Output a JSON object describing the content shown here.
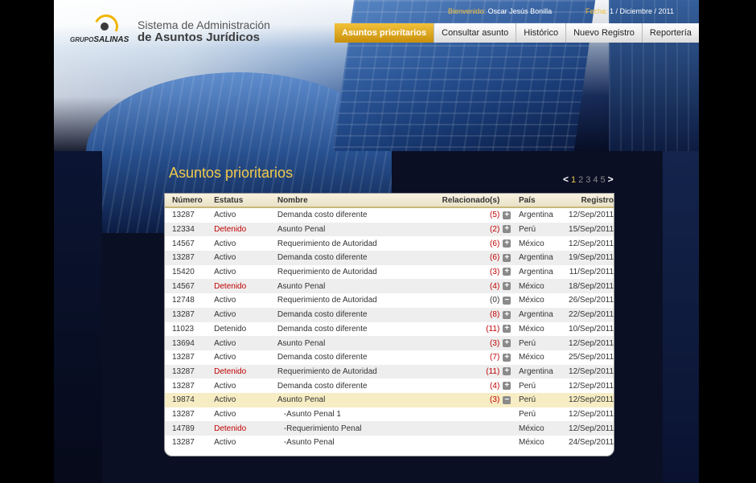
{
  "header": {
    "brand_small": "GRUPO",
    "brand_big": "SALINAS",
    "title_line1": "Sistema de Administración",
    "title_line2": "de Asuntos Jurídicos",
    "welcome_label": "Bienvenido:",
    "welcome_user": "Oscar Jesús Bonilla",
    "date_label": "Fecha:",
    "date_value": "1 / Diciembre / 2011"
  },
  "nav": [
    {
      "label": "Asuntos prioritarios",
      "active": true
    },
    {
      "label": "Consultar asunto",
      "active": false
    },
    {
      "label": "Histórico",
      "active": false
    },
    {
      "label": "Nuevo Registro",
      "active": false
    },
    {
      "label": "Reportería",
      "active": false
    }
  ],
  "section": {
    "title": "Asuntos prioritarios",
    "pager": {
      "prev": "<",
      "next": ">",
      "pages": [
        "1",
        "2",
        "3",
        "4",
        "5"
      ],
      "current": "1"
    }
  },
  "table": {
    "headers": {
      "numero": "Número",
      "estatus": "Estatus",
      "nombre": "Nombre",
      "relacionados": "Relacionado(s)",
      "pais": "País",
      "registro": "Registro"
    },
    "rows": [
      {
        "numero": "13287",
        "estatus": "Activo",
        "nombre": "Demanda costo diferente",
        "rel": "(5)",
        "rel_red": true,
        "toggle": "+",
        "pais": "Argentina",
        "registro": "12/Sep/2011"
      },
      {
        "numero": "12334",
        "estatus": "Detenido",
        "estatus_red": true,
        "nombre": "Asunto Penal",
        "rel": "(2)",
        "rel_red": true,
        "toggle": "+",
        "pais": "Perú",
        "registro": "15/Sep/2011"
      },
      {
        "numero": "14567",
        "estatus": "Activo",
        "nombre": "Requerimiento de Autoridad",
        "rel": "(6)",
        "rel_red": true,
        "toggle": "+",
        "pais": "México",
        "registro": "12/Sep/2011"
      },
      {
        "numero": "13287",
        "estatus": "Activo",
        "nombre": "Demanda costo diferente",
        "rel": "(6)",
        "rel_red": true,
        "toggle": "+",
        "pais": "Argentina",
        "registro": "19/Sep/2011"
      },
      {
        "numero": "15420",
        "estatus": "Activo",
        "nombre": "Requerimiento de Autoridad",
        "rel": "(3)",
        "rel_red": true,
        "toggle": "+",
        "pais": "Argentina",
        "registro": "11/Sep/2011"
      },
      {
        "numero": "14567",
        "estatus": "Detenido",
        "estatus_red": true,
        "nombre": "Asunto Penal",
        "rel": "(4)",
        "rel_red": true,
        "toggle": "+",
        "pais": "México",
        "registro": "18/Sep/2011"
      },
      {
        "numero": "12748",
        "estatus": "Activo",
        "nombre": "Requerimiento de Autoridad",
        "rel": "(0)",
        "rel_red": false,
        "toggle": "−",
        "pais": "México",
        "registro": "26/Sep/2011"
      },
      {
        "numero": "13287",
        "estatus": "Activo",
        "nombre": "Demanda costo diferente",
        "rel": "(8)",
        "rel_red": true,
        "toggle": "+",
        "pais": "Argentina",
        "registro": "22/Sep/2011"
      },
      {
        "numero": "11023",
        "estatus": "Detenido",
        "nombre": "Demanda costo diferente",
        "rel": "(11)",
        "rel_red": true,
        "toggle": "+",
        "pais": "México",
        "registro": "10/Sep/2011"
      },
      {
        "numero": "13694",
        "estatus": "Activo",
        "nombre": "Asunto Penal",
        "rel": "(3)",
        "rel_red": true,
        "toggle": "+",
        "pais": "Perú",
        "registro": "12/Sep/2011"
      },
      {
        "numero": "13287",
        "estatus": "Activo",
        "nombre": "Demanda costo diferente",
        "rel": "(7)",
        "rel_red": true,
        "toggle": "+",
        "pais": "México",
        "registro": "25/Sep/2011"
      },
      {
        "numero": "13287",
        "estatus": "Detenido",
        "estatus_red": true,
        "nombre": "Requerimiento de Autoridad",
        "rel": "(11)",
        "rel_red": true,
        "toggle": "+",
        "pais": "Argentina",
        "registro": "12/Sep/2011"
      },
      {
        "numero": "13287",
        "estatus": "Activo",
        "nombre": "Demanda costo diferente",
        "rel": "(4)",
        "rel_red": true,
        "toggle": "+",
        "pais": "Perú",
        "registro": "12/Sep/2011"
      },
      {
        "numero": "19874",
        "estatus": "Activo",
        "nombre": "Asunto Penal",
        "rel": "(3)",
        "rel_red": true,
        "toggle": "−",
        "pais": "Perú",
        "registro": "12/Sep/2011",
        "highlight": true
      },
      {
        "numero": "13287",
        "estatus": "Activo",
        "nombre": "-Asunto Penal 1",
        "rel": "",
        "toggle": "",
        "pais": "Perú",
        "registro": "12/Sep/2011",
        "child": true
      },
      {
        "numero": "14789",
        "estatus": "Detenido",
        "estatus_red": true,
        "nombre": "-Requerimiento Penal",
        "rel": "",
        "toggle": "",
        "pais": "México",
        "registro": "12/Sep/2011",
        "child": true
      },
      {
        "numero": "13287",
        "estatus": "Activo",
        "nombre": "-Asunto Penal",
        "rel": "",
        "toggle": "",
        "pais": "México",
        "registro": "24/Sep/2011",
        "child": true
      }
    ]
  }
}
